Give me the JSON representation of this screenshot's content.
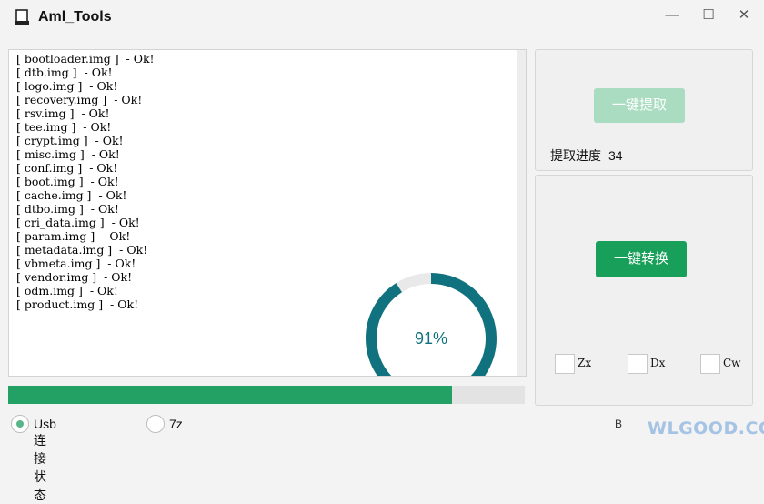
{
  "window": {
    "title": "Aml_Tools",
    "minimize_glyph": "—",
    "maximize_glyph": "☐",
    "close_glyph": "✕"
  },
  "log": {
    "lines": [
      "[ bootloader.img ]  - Ok!",
      "[ dtb.img ]  - Ok!",
      "[ logo.img ]  - Ok!",
      "[ recovery.img ]  - Ok!",
      "[ rsv.img ]  - Ok!",
      "[ tee.img ]  - Ok!",
      "[ crypt.img ]  - Ok!",
      "[ misc.img ]  - Ok!",
      "[ conf.img ]  - Ok!",
      "[ boot.img ]  - Ok!",
      "[ cache.img ]  - Ok!",
      "[ dtbo.img ]  - Ok!",
      "[ cri_data.img ]  - Ok!",
      "[ param.img ]  - Ok!",
      "[ metadata.img ]  - Ok!",
      "[ vbmeta.img ]  - Ok!",
      "[ vendor.img ]  - Ok!",
      "[ odm.img ]  - Ok!",
      "[ product.img ]  - Ok!"
    ]
  },
  "ring": {
    "label": "91%",
    "value": 0.91,
    "color": "#10727e",
    "track_color": "#e9e9e9"
  },
  "main_progress": {
    "value": 0.86,
    "color": "#23a063"
  },
  "extract": {
    "button_label": "一键提取",
    "progress_label": "提取进度",
    "progress_value": "34"
  },
  "convert": {
    "button_label": "一键转换",
    "options": [
      {
        "label": "Zx",
        "checked": false
      },
      {
        "label": "Dx",
        "checked": false
      },
      {
        "label": "Cw",
        "checked": false
      }
    ]
  },
  "status": {
    "usb_label": "Usb连接状态",
    "sevenz_label": "7z",
    "footer_text": "B"
  },
  "watermark": {
    "text": "WLGOOD.COM"
  }
}
